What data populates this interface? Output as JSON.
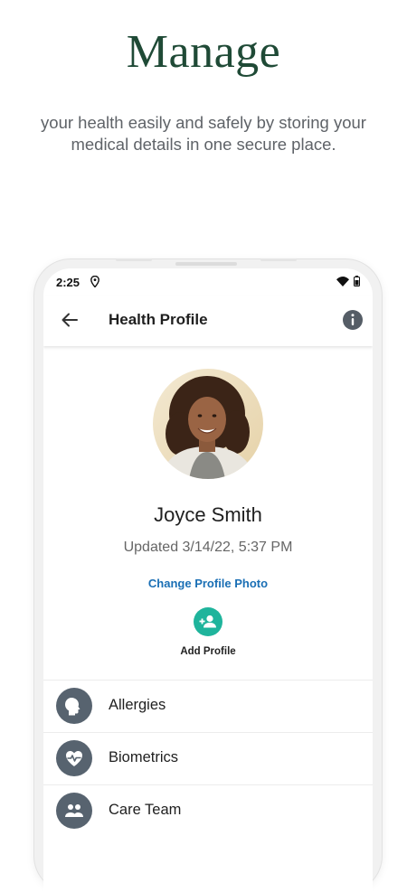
{
  "promo": {
    "headline": "Manage",
    "subtitle": "your health easily and safely by storing your medical details in one secure place."
  },
  "status_bar": {
    "time": "2:25"
  },
  "app_bar": {
    "title": "Health Profile"
  },
  "profile": {
    "name": "Joyce Smith",
    "updated": "Updated 3/14/22, 5:37 PM",
    "change_photo_label": "Change Profile Photo",
    "add_profile_label": "Add Profile"
  },
  "menu": {
    "items": [
      {
        "label": "Allergies",
        "icon": "allergies-head-icon"
      },
      {
        "label": "Biometrics",
        "icon": "heart-pulse-icon"
      },
      {
        "label": "Care Team",
        "icon": "group-people-icon"
      }
    ]
  },
  "colors": {
    "headline": "#1f4a36",
    "accent_teal": "#1fb49c",
    "link_blue": "#1a6fb5",
    "icon_circle": "#57636f"
  }
}
